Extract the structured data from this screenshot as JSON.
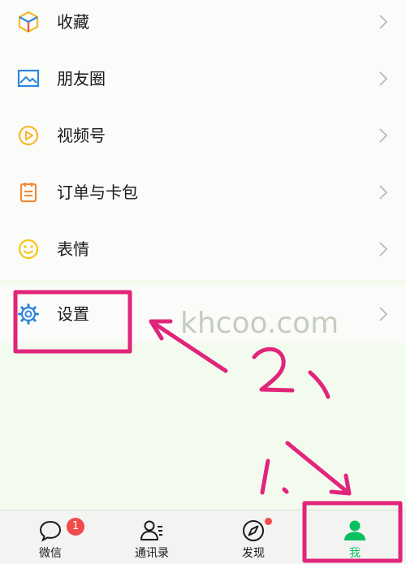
{
  "menu": {
    "items": [
      {
        "label": "收藏",
        "icon": "favorites-cube-icon"
      },
      {
        "label": "朋友圈",
        "icon": "moments-picture-icon"
      },
      {
        "label": "视频号",
        "icon": "channels-play-icon"
      },
      {
        "label": "订单与卡包",
        "icon": "orders-cards-icon"
      },
      {
        "label": "表情",
        "icon": "stickers-smiley-icon"
      }
    ],
    "settings": {
      "label": "设置",
      "icon": "gear-icon"
    }
  },
  "watermark": "khcoo.com",
  "tabbar": {
    "tabs": [
      {
        "label": "微信",
        "icon": "chat-bubble-icon",
        "badge": "1"
      },
      {
        "label": "通讯录",
        "icon": "contacts-icon"
      },
      {
        "label": "发现",
        "icon": "compass-icon"
      },
      {
        "label": "我",
        "icon": "person-icon",
        "active": true
      }
    ]
  },
  "colors": {
    "accent_green": "#07c160",
    "annotation_pink": "#e0257a",
    "badge_red": "#f04a4a",
    "icon_yellow": "#f5b82e",
    "icon_blue": "#2e86de",
    "icon_orange": "#f08a3a"
  }
}
